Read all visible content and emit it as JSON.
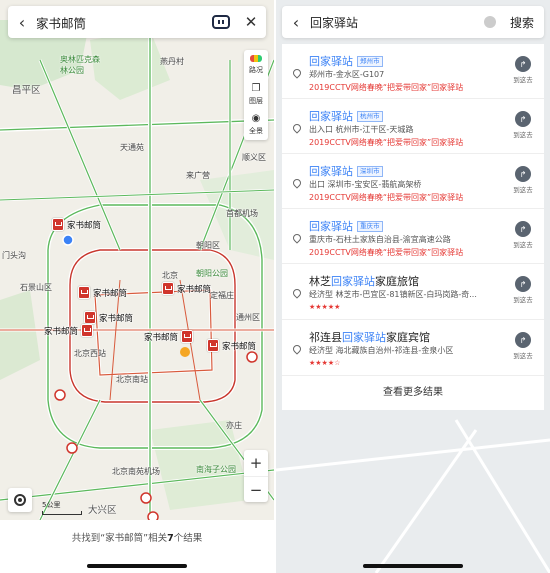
{
  "left": {
    "search": {
      "back_icon": "chevron-left-icon",
      "query": "家书邮筒",
      "close_icon": "close-icon"
    },
    "tools": [
      {
        "label": "路况",
        "icon": "traffic-icon"
      },
      {
        "label": "图层",
        "icon": "layers-icon"
      },
      {
        "label": "全景",
        "icon": "panorama-icon"
      }
    ],
    "zoom": {
      "in": "+",
      "out": "−"
    },
    "scale": "5公里",
    "markers": [
      {
        "label": "家书邮筒"
      },
      {
        "label": "家书邮筒"
      },
      {
        "label": "家书邮筒"
      },
      {
        "label": "家书邮筒"
      },
      {
        "label": "家书邮筒"
      },
      {
        "label": "家书邮筒"
      },
      {
        "label": "家书邮筒"
      }
    ],
    "places": [
      "昌平区",
      "天通苑",
      "北京西站",
      "北京南站",
      "北京南苑机场",
      "南海子公园",
      "大兴区",
      "首都机场",
      "顺义区",
      "燕丹村",
      "朝阳区",
      "北京",
      "通州区",
      "亦庄",
      "石景山区",
      "门头沟",
      "来广营",
      "定福庄"
    ],
    "map_labels": {
      "park": "奥林匹克森林公园",
      "park2": "朝阳公园"
    },
    "summary": {
      "prefix": "共找到“家书邮筒”相关",
      "count": "7",
      "suffix": "个结果"
    }
  },
  "right": {
    "search": {
      "back_icon": "chevron-left-icon",
      "query": "回家驿站",
      "search_button": "搜索"
    },
    "results": [
      {
        "title_hl": "回家驿站",
        "title_rest": "",
        "tag": "郑州市",
        "address": "郑州市-金水区-G107",
        "note": "2019CCTV网络春晚“把爱带回家”回家驿站",
        "action": "到这去"
      },
      {
        "title_hl": "回家驿站",
        "title_rest": "",
        "tag": "杭州市",
        "address": "出入口  杭州市-江干区-天城路",
        "note": "2019CCTV网络春晚“把爱带回家”回家驿站",
        "action": "到这去"
      },
      {
        "title_hl": "回家驿站",
        "title_rest": "",
        "tag": "深圳市",
        "address": "出口  深圳市-宝安区-翡航高架桥",
        "note": "2019CCTV网络春晚“把爱带回家”回家驿站",
        "action": "到这去"
      },
      {
        "title_hl": "回家驿站",
        "title_rest": "",
        "tag": "重庆市",
        "address": "重庆市-石柱土家族自治县-渝宜高速公路",
        "note": "2019CCTV网络春晚“把爱带回家”回家驿站",
        "action": "到这去"
      },
      {
        "title_pre": "林芝",
        "title_hl": "回家驿站",
        "title_rest": "家庭旅馆",
        "address": "经济型  林芝市-巴宜区-81镇新区-白玛岗路-奇...",
        "stars": "★★★★★",
        "action": "到这去"
      },
      {
        "title_pre": "祁连县",
        "title_hl": "回家驿站",
        "title_rest": "家庭宾馆",
        "address": "经济型  海北藏族自治州-祁连县-金泉小区",
        "stars": "★★★★☆",
        "action": "到这去"
      }
    ],
    "more": "查看更多结果"
  }
}
